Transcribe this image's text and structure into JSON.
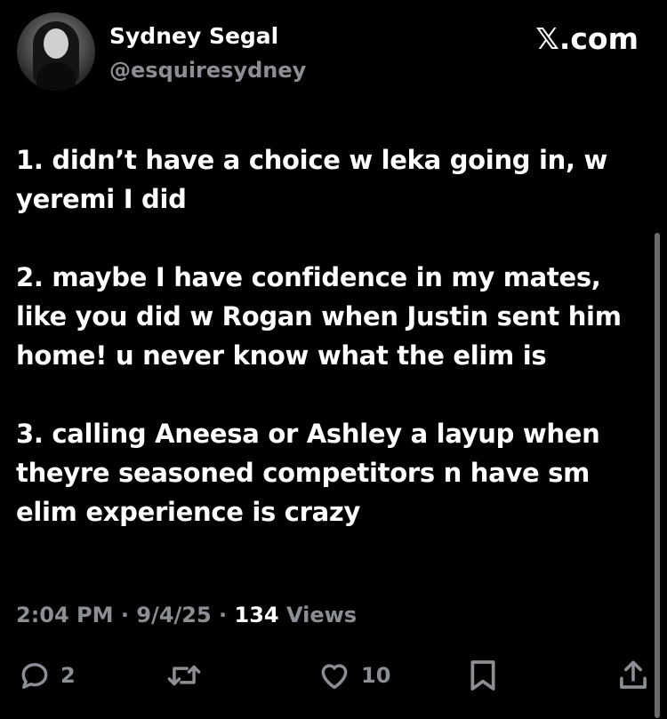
{
  "author": {
    "display_name": "Sydney Segal",
    "handle": "@esquiresydney",
    "avatar_icon": "profile-photo"
  },
  "brand": {
    "label": "𝕏.com"
  },
  "tweet": {
    "paragraphs": [
      "1. didn’t have a choice w leka going in, w\nyeremi I did",
      "2. maybe I have confidence in my mates,\nlike you did w Rogan when Justin sent him\nhome! u never know what the elim is",
      "3. calling Aneesa or Ashley a layup when\ntheyre seasoned competitors n have sm\nelim experience is crazy"
    ]
  },
  "meta": {
    "time": "2:04 PM",
    "sep1": " · ",
    "date": "9/4/25",
    "sep2": " · ",
    "views_count": "134",
    "views_label": " Views"
  },
  "actions": {
    "reply_icon": "reply-icon",
    "reply_count": "2",
    "retweet_icon": "retweet-icon",
    "like_icon": "heart-icon",
    "like_count": "10",
    "bookmark_icon": "bookmark-icon",
    "share_icon": "share-icon"
  },
  "colors": {
    "background": "#000000",
    "text_primary": "#ffffff",
    "text_secondary": "#8b8f94"
  }
}
